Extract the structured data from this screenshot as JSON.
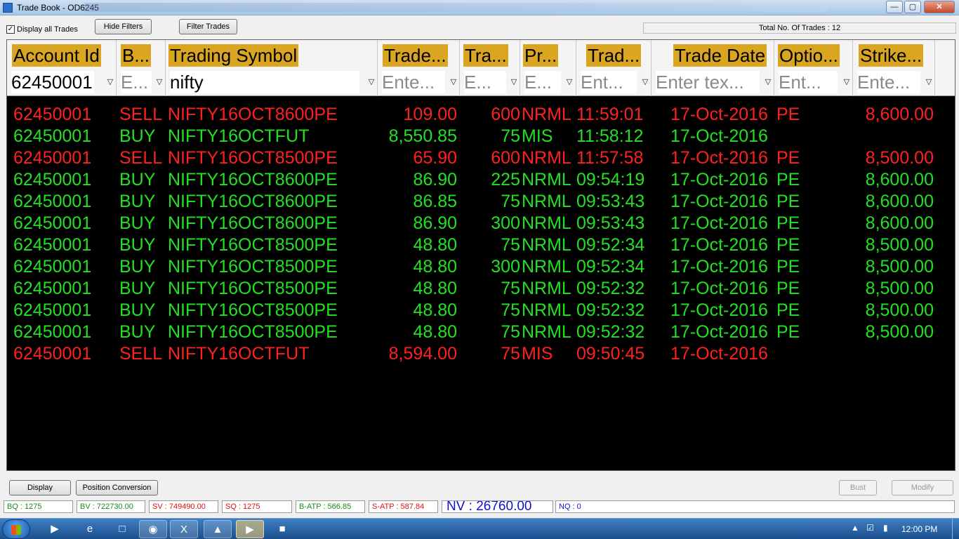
{
  "window": {
    "title": "Trade Book - OD6245",
    "minimize_icon": "minimize-icon",
    "maximize_icon": "maximize-icon",
    "close_icon": "close-icon"
  },
  "toolbar": {
    "display_all_label": "Display all Trades",
    "display_all_checked": true,
    "hide_filters_label": "Hide Filters",
    "filter_trades_label": "Filter Trades",
    "total_trades_label": "Total No. Of Trades : 12"
  },
  "columns": [
    {
      "header": "Account Id",
      "filter_value": "62450001",
      "filter_placeholder": ""
    },
    {
      "header": "B...",
      "filter_value": "",
      "filter_placeholder": "E..."
    },
    {
      "header": "Trading Symbol",
      "filter_value": "nifty",
      "filter_placeholder": ""
    },
    {
      "header": "Trade...",
      "filter_value": "",
      "filter_placeholder": "Ente..."
    },
    {
      "header": "Tra...",
      "filter_value": "",
      "filter_placeholder": "E..."
    },
    {
      "header": "Pr...",
      "filter_value": "",
      "filter_placeholder": "E..."
    },
    {
      "header": "Trad...",
      "filter_value": "",
      "filter_placeholder": "Ent..."
    },
    {
      "header": "Trade Date",
      "filter_value": "",
      "filter_placeholder": "Enter tex..."
    },
    {
      "header": "Optio...",
      "filter_value": "",
      "filter_placeholder": "Ent..."
    },
    {
      "header": "Strike...",
      "filter_value": "",
      "filter_placeholder": "Ente..."
    }
  ],
  "trades": [
    {
      "account": "62450001",
      "side": "SELL",
      "symbol": "NIFTY16OCT8600PE",
      "price": "109.00",
      "qty": "600",
      "product": "NRML",
      "time": "11:59:01",
      "date": "17-Oct-2016",
      "option": "PE",
      "strike": "8,600.00"
    },
    {
      "account": "62450001",
      "side": "BUY",
      "symbol": "NIFTY16OCTFUT",
      "price": "8,550.85",
      "qty": "75",
      "product": "MIS",
      "time": "11:58:12",
      "date": "17-Oct-2016",
      "option": "",
      "strike": ""
    },
    {
      "account": "62450001",
      "side": "SELL",
      "symbol": "NIFTY16OCT8500PE",
      "price": "65.90",
      "qty": "600",
      "product": "NRML",
      "time": "11:57:58",
      "date": "17-Oct-2016",
      "option": "PE",
      "strike": "8,500.00"
    },
    {
      "account": "62450001",
      "side": "BUY",
      "symbol": "NIFTY16OCT8600PE",
      "price": "86.90",
      "qty": "225",
      "product": "NRML",
      "time": "09:54:19",
      "date": "17-Oct-2016",
      "option": "PE",
      "strike": "8,600.00"
    },
    {
      "account": "62450001",
      "side": "BUY",
      "symbol": "NIFTY16OCT8600PE",
      "price": "86.85",
      "qty": "75",
      "product": "NRML",
      "time": "09:53:43",
      "date": "17-Oct-2016",
      "option": "PE",
      "strike": "8,600.00"
    },
    {
      "account": "62450001",
      "side": "BUY",
      "symbol": "NIFTY16OCT8600PE",
      "price": "86.90",
      "qty": "300",
      "product": "NRML",
      "time": "09:53:43",
      "date": "17-Oct-2016",
      "option": "PE",
      "strike": "8,600.00"
    },
    {
      "account": "62450001",
      "side": "BUY",
      "symbol": "NIFTY16OCT8500PE",
      "price": "48.80",
      "qty": "75",
      "product": "NRML",
      "time": "09:52:34",
      "date": "17-Oct-2016",
      "option": "PE",
      "strike": "8,500.00"
    },
    {
      "account": "62450001",
      "side": "BUY",
      "symbol": "NIFTY16OCT8500PE",
      "price": "48.80",
      "qty": "300",
      "product": "NRML",
      "time": "09:52:34",
      "date": "17-Oct-2016",
      "option": "PE",
      "strike": "8,500.00"
    },
    {
      "account": "62450001",
      "side": "BUY",
      "symbol": "NIFTY16OCT8500PE",
      "price": "48.80",
      "qty": "75",
      "product": "NRML",
      "time": "09:52:32",
      "date": "17-Oct-2016",
      "option": "PE",
      "strike": "8,500.00"
    },
    {
      "account": "62450001",
      "side": "BUY",
      "symbol": "NIFTY16OCT8500PE",
      "price": "48.80",
      "qty": "75",
      "product": "NRML",
      "time": "09:52:32",
      "date": "17-Oct-2016",
      "option": "PE",
      "strike": "8,500.00"
    },
    {
      "account": "62450001",
      "side": "BUY",
      "symbol": "NIFTY16OCT8500PE",
      "price": "48.80",
      "qty": "75",
      "product": "NRML",
      "time": "09:52:32",
      "date": "17-Oct-2016",
      "option": "PE",
      "strike": "8,500.00"
    },
    {
      "account": "62450001",
      "side": "SELL",
      "symbol": "NIFTY16OCTFUT",
      "price": "8,594.00",
      "qty": "75",
      "product": "MIS",
      "time": "09:50:45",
      "date": "17-Oct-2016",
      "option": "",
      "strike": ""
    }
  ],
  "actions": {
    "display_label": "Display",
    "position_conversion_label": "Position Conversion",
    "bust_label": "Bust",
    "modify_label": "Modify"
  },
  "status": {
    "bq": "BQ : 1275",
    "bv": "BV : 722730.00",
    "sv": "SV : 749490.00",
    "sq": "SQ : 1275",
    "batp": "B-ATP : 566.85",
    "satp": "S-ATP : 587.84",
    "nv": "NV : 26760.00",
    "nq": "NQ : 0"
  },
  "taskbar": {
    "clock": "12:00 PM",
    "items": [
      "media-player-icon",
      "internet-explorer-icon",
      "file-explorer-icon",
      "chrome-icon",
      "excel-icon",
      "trading-app-icon",
      "trade-book-icon",
      "misc-app-icon"
    ]
  },
  "colors": {
    "sell": "#ff2020",
    "buy": "#22e022",
    "header_highlight": "#daa520",
    "grid_background": "#000000"
  }
}
